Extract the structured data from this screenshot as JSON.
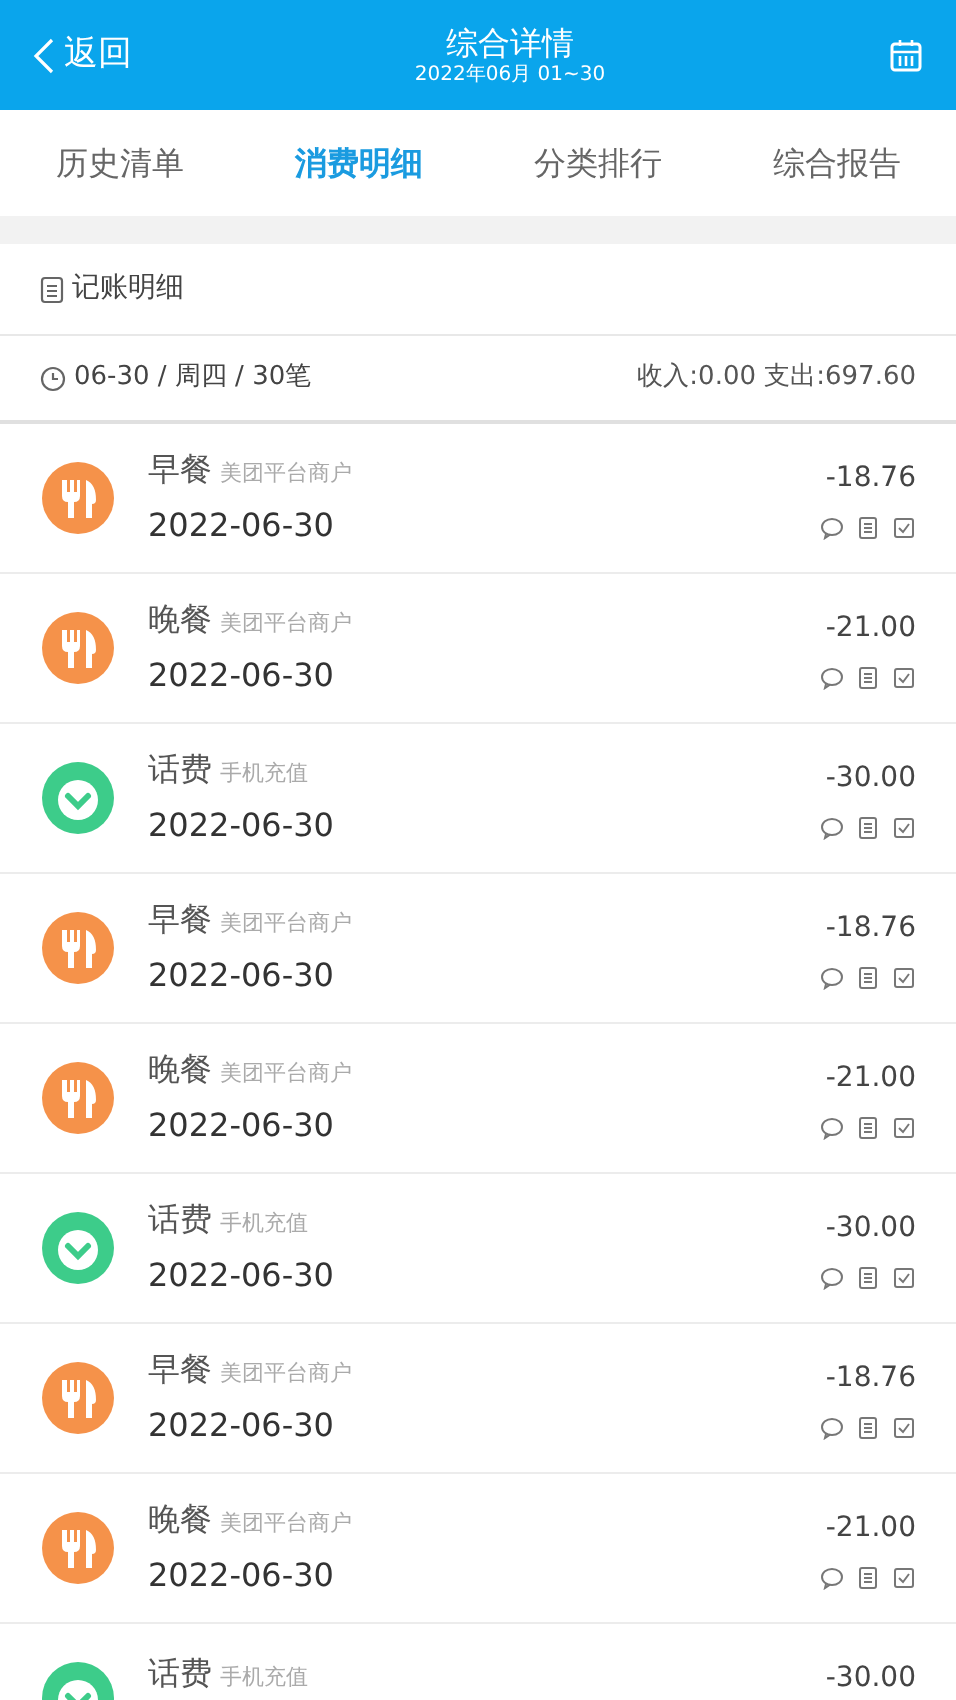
{
  "header": {
    "back": "返回",
    "title": "综合详情",
    "subtitle": "2022年06月 01~30"
  },
  "tabs": [
    {
      "label": "历史清单",
      "selected": false
    },
    {
      "label": "消费明细",
      "selected": true
    },
    {
      "label": "分类排行",
      "selected": false
    },
    {
      "label": "综合报告",
      "selected": false
    }
  ],
  "section": {
    "title": "记账明细"
  },
  "summary": {
    "date": "06-30 / 周四 / 30笔",
    "totals": "收入:0.00 支出:697.60"
  },
  "rows": [
    {
      "kind": "food",
      "title": "早餐",
      "merchant": "美团平台商户",
      "date": "2022-06-30",
      "amount": "-18.76"
    },
    {
      "kind": "food",
      "title": "晚餐",
      "merchant": "美团平台商户",
      "date": "2022-06-30",
      "amount": "-21.00"
    },
    {
      "kind": "phone",
      "title": "话费",
      "merchant": "手机充值",
      "date": "2022-06-30",
      "amount": "-30.00"
    },
    {
      "kind": "food",
      "title": "早餐",
      "merchant": "美团平台商户",
      "date": "2022-06-30",
      "amount": "-18.76"
    },
    {
      "kind": "food",
      "title": "晚餐",
      "merchant": "美团平台商户",
      "date": "2022-06-30",
      "amount": "-21.00"
    },
    {
      "kind": "phone",
      "title": "话费",
      "merchant": "手机充值",
      "date": "2022-06-30",
      "amount": "-30.00"
    },
    {
      "kind": "food",
      "title": "早餐",
      "merchant": "美团平台商户",
      "date": "2022-06-30",
      "amount": "-18.76"
    },
    {
      "kind": "food",
      "title": "晚餐",
      "merchant": "美团平台商户",
      "date": "2022-06-30",
      "amount": "-21.00"
    },
    {
      "kind": "phone",
      "title": "话费",
      "merchant": "手机充值",
      "amount": "-30.00"
    }
  ]
}
